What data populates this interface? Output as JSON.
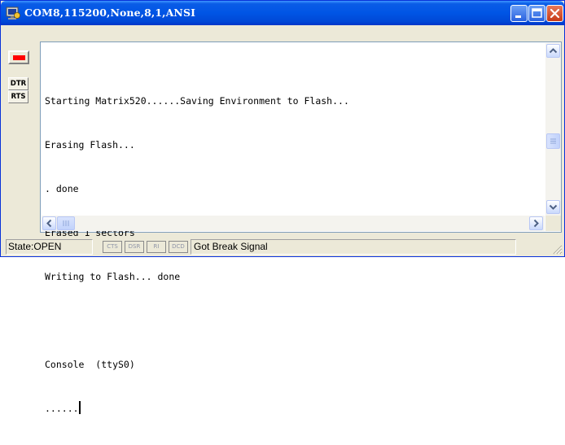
{
  "window": {
    "title": "COM8,115200,None,8,1,ANSI",
    "accent": "#0055e5"
  },
  "titlebar_buttons": {
    "minimize_icon": "minimize-icon",
    "maximize_icon": "maximize-icon",
    "close_icon": "close-icon"
  },
  "controls": {
    "led_color": "#ff0000",
    "dtr_label": "DTR",
    "rts_label": "RTS"
  },
  "terminal": {
    "lines": [
      "Starting Matrix520......Saving Environment to Flash...",
      "Erasing Flash...",
      ". done",
      "Erased 1 sectors",
      "Writing to Flash... done",
      "",
      "Console  (ttyS0)",
      "......"
    ]
  },
  "status": {
    "state": "State:OPEN",
    "signals": [
      "CTS",
      "DSR",
      "RI",
      "DCD"
    ],
    "message": "Got Break Signal"
  }
}
